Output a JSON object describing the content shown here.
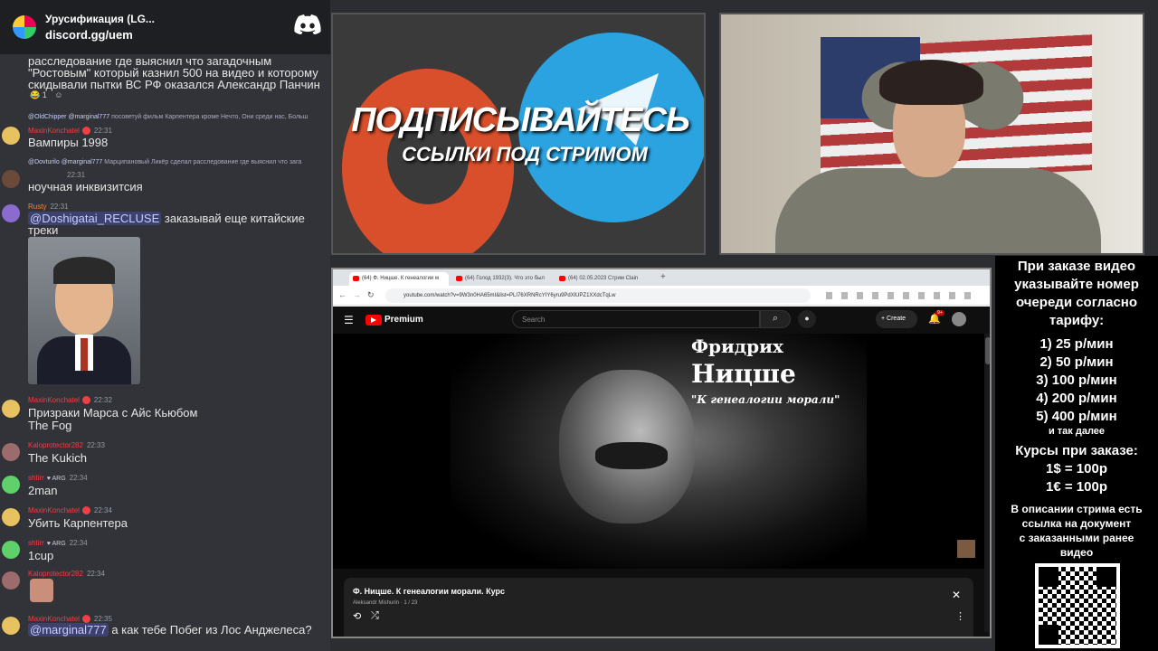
{
  "server": {
    "name": "Урусификация (LG...",
    "invite": "discord.gg/uem"
  },
  "chat": {
    "top_text_1": "расследование где выяснил что загадочным",
    "top_text_2": "\"Ростовым\" который казнил 500 на видео и которому",
    "top_text_3": "скидывали пытки ВС РФ оказался Александр Панчин",
    "top_reaction_count": "1",
    "messages": [
      {
        "reply_user": "@OldChipper",
        "reply_mention": "@marginal777",
        "reply_text": "посоветуй фильм Карпентера кроме Нечто, Они среди нас, Больш",
        "user": "MaxinKonchatel",
        "time": "22:31",
        "text": "Вампиры 1998"
      },
      {
        "reply_user": "@Dovturilo",
        "reply_mention": "@marginal777",
        "reply_text": "Марципановый Ликёр сделал расследование где выяснил что зага",
        "time": "22:31",
        "text": "ноучная инквизитсия"
      },
      {
        "user": "Rusty",
        "time": "22:31",
        "mention": "@Doshigatai_RECLUSE",
        "text": "заказывай еще китайские",
        "text2": "треки"
      },
      {
        "user": "MaxinKonchatel",
        "time": "22:32",
        "text": "Призраки Марса с Айс Кьюбом",
        "text2": "The Fog"
      },
      {
        "user": "Kaloprotector282",
        "time": "22:33",
        "text": "The Kukich"
      },
      {
        "user": "shtirr",
        "tag": "ARG",
        "time": "22:34",
        "text": "2man"
      },
      {
        "user": "MaxinKonchatel",
        "time": "22:34",
        "text": "Убить Карпентера"
      },
      {
        "user": "shtirr",
        "tag": "ARG",
        "time": "22:34",
        "text": "1cup"
      },
      {
        "user": "Kaloprotector282",
        "time": "22:34"
      },
      {
        "user": "MaxinKonchatel",
        "time": "22:35",
        "mention": "@marginal777",
        "text": "а как тебе Побег из Лос Анджелеса?"
      }
    ]
  },
  "promo": {
    "line1": "ПОДПИСЫВАЙТЕСЬ",
    "line2": "ССЫЛКИ ПОД СТРИМОМ"
  },
  "browser": {
    "tabs": [
      "(64) Ф. Ницше. К генеалогии м",
      "(64) Голод 1932(3). Что это был",
      "(64) 02.05.2023 Стрим Сlain"
    ],
    "url": "youtube.com/watch?v=9W3n0HA65mI&list=PLI76XRNRcYIY6yru9PdXlUPZ1XXdcTqLw",
    "yt_brand": "Premium",
    "search_placeholder": "Search",
    "create_label": "Create",
    "notif_count": "9+",
    "video_title_1": "Фридрих",
    "video_title_2": "Ницше",
    "video_title_3": "\"К генеалогии морали\"",
    "playlist_title": "Ф. Ницше. К генеалогии морали. Курс",
    "playlist_author": "Aleksandr Mishurin · 1 / 23"
  },
  "side": {
    "heading": [
      "При заказе видео",
      "указывайте номер",
      "очереди согласно",
      "тарифу:"
    ],
    "rates": [
      "1) 25 р/мин",
      "2) 50 р/мин",
      "3) 100 р/мин",
      "4) 200 р/мин",
      "5) 400 р/мин"
    ],
    "etc": "и так далее",
    "courses_title": "Курсы при заказе:",
    "courses": [
      "1$ = 100р",
      "1€ = 100р"
    ],
    "desc": [
      "В описании стрима есть",
      "ссылка на документ",
      "с заказанными ранее",
      "видео"
    ]
  },
  "colors": {
    "discord_bg": "#313338",
    "username_red": "#f23f43",
    "yt_red": "#ff0000",
    "telegram": "#2aa3e0"
  }
}
